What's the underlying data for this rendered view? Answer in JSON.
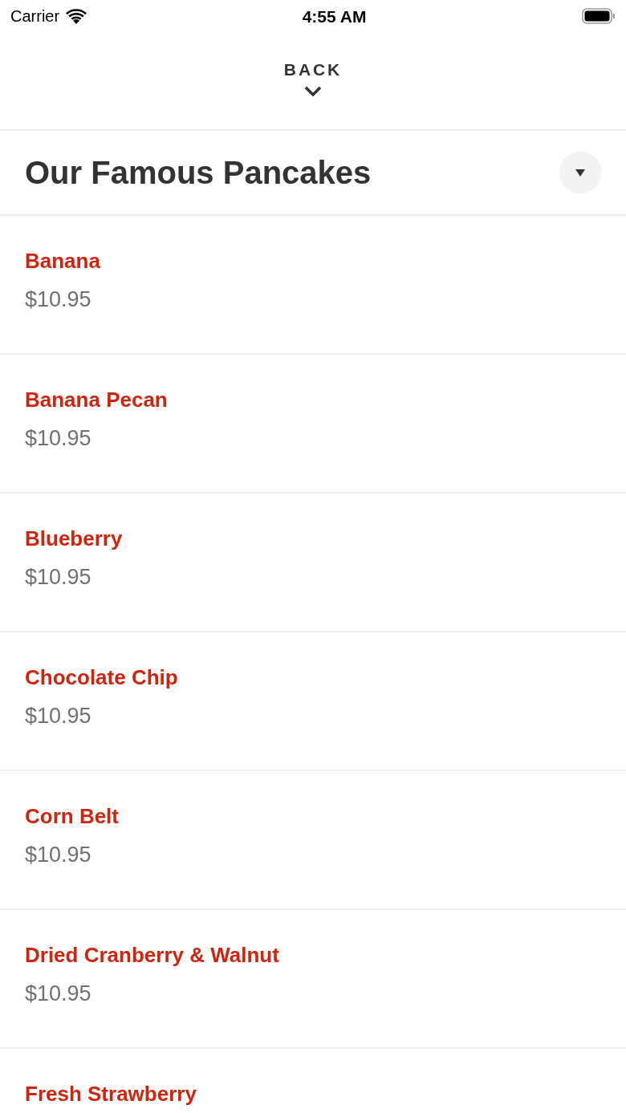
{
  "status_bar": {
    "carrier": "Carrier",
    "time": "4:55 AM"
  },
  "header": {
    "back_label": "BACK"
  },
  "section": {
    "title": "Our Famous Pancakes"
  },
  "items": [
    {
      "name": "Banana",
      "price": "$10.95"
    },
    {
      "name": "Banana Pecan",
      "price": "$10.95"
    },
    {
      "name": "Blueberry",
      "price": "$10.95"
    },
    {
      "name": "Chocolate Chip",
      "price": "$10.95"
    },
    {
      "name": "Corn Belt",
      "price": "$10.95"
    },
    {
      "name": "Dried Cranberry & Walnut",
      "price": "$10.95"
    },
    {
      "name": "Fresh Strawberry"
    }
  ]
}
